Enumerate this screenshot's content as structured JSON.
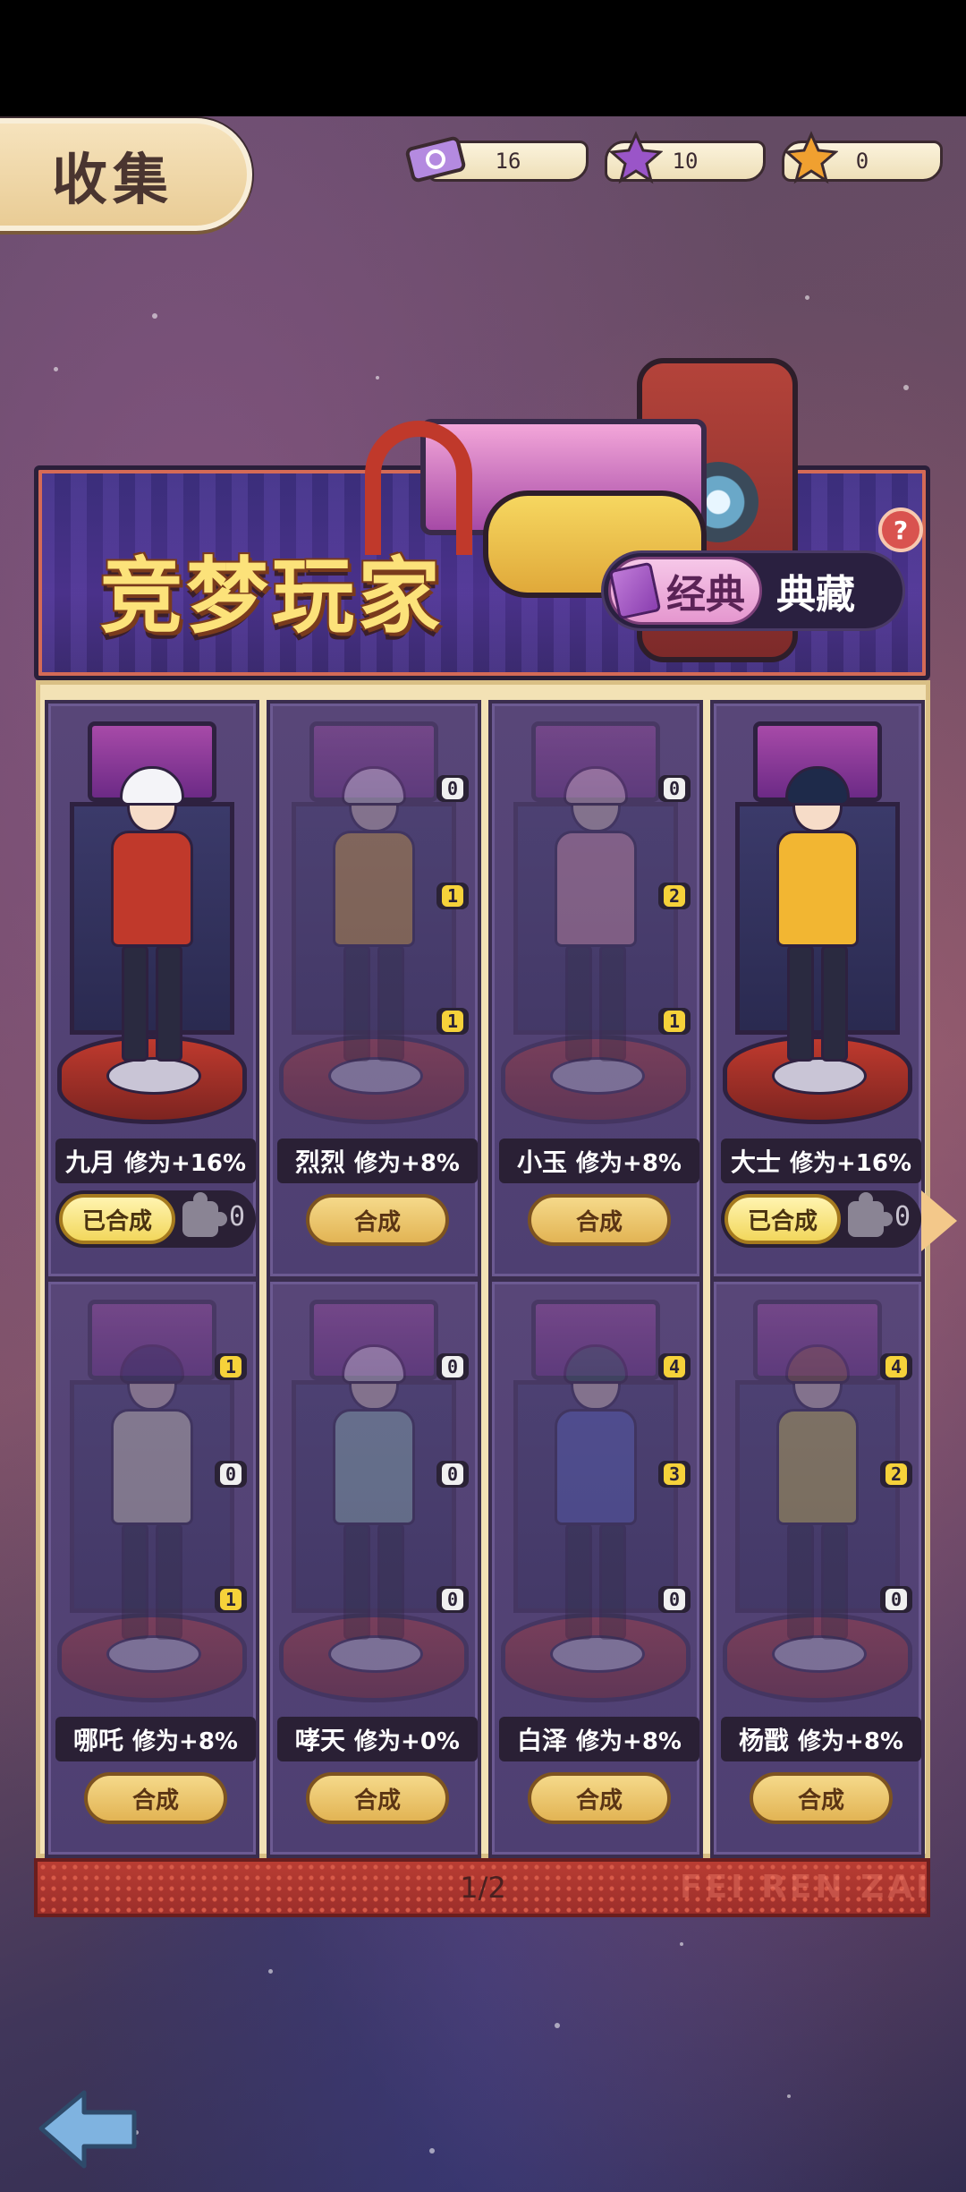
{
  "header": {
    "title": "收集"
  },
  "currencies": [
    {
      "icon": "ticket-icon",
      "value": "16",
      "color": "#b48ae0"
    },
    {
      "icon": "purple-star-icon",
      "value": "10",
      "color": "#9a55c8"
    },
    {
      "icon": "orange-star-icon",
      "value": "0",
      "color": "#f0a030"
    }
  ],
  "banner": {
    "title": "竞梦玩家",
    "help": "?",
    "tabs": [
      "经典",
      "典藏"
    ],
    "active_tab": "经典"
  },
  "cards": [
    {
      "name": "九月",
      "bonus": "修为+16%",
      "state": "crafted",
      "button": "已合成",
      "fragments_owned": "0",
      "badges": [],
      "colors": {
        "hair": "#f4f4f8",
        "top": "#c0392b"
      }
    },
    {
      "name": "烈烈",
      "bonus": "修为+8%",
      "state": "craftable",
      "button": "合成",
      "badges": [
        "0",
        "1",
        "1"
      ],
      "colors": {
        "hair": "#f4f4f8",
        "top": "#f2b632"
      }
    },
    {
      "name": "小玉",
      "bonus": "修为+8%",
      "state": "craftable",
      "button": "合成",
      "badges": [
        "0",
        "2",
        "1"
      ],
      "colors": {
        "hair": "#f7d9df",
        "top": "#f4a7b9"
      }
    },
    {
      "name": "大士",
      "bonus": "修为+16%",
      "state": "crafted",
      "button": "已合成",
      "fragments_owned": "0",
      "badges": [],
      "colors": {
        "hair": "#1e2a4a",
        "top": "#f2b632"
      }
    },
    {
      "name": "哪吒",
      "bonus": "修为+8%",
      "state": "craftable",
      "button": "合成",
      "badges": [
        "1",
        "0",
        "1"
      ],
      "colors": {
        "hair": "#2a2a55",
        "top": "#f6f0d0"
      }
    },
    {
      "name": "哮天",
      "bonus": "修为+0%",
      "state": "craftable",
      "button": "合成",
      "badges": [
        "0",
        "0",
        "0"
      ],
      "colors": {
        "hair": "#e8e8ee",
        "top": "#9fd3c7"
      }
    },
    {
      "name": "白泽",
      "bonus": "修为+8%",
      "state": "craftable",
      "button": "合成",
      "badges": [
        "4",
        "3",
        "0"
      ],
      "colors": {
        "hair": "#2f5a5a",
        "top": "#5a6acb"
      }
    },
    {
      "name": "杨戬",
      "bonus": "修为+8%",
      "state": "craftable",
      "button": "合成",
      "badges": [
        "4",
        "2",
        "0"
      ],
      "colors": {
        "hair": "#8a5a3a",
        "top": "#e6d84a"
      }
    }
  ],
  "pagination": {
    "current": "1/2"
  },
  "watermark": "FEI REN ZAI"
}
